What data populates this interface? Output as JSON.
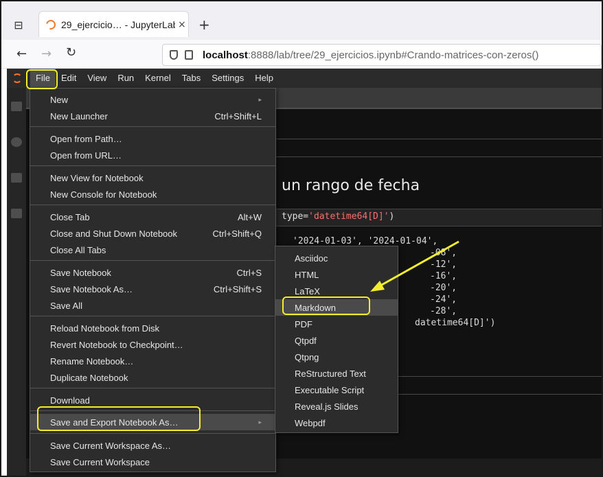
{
  "browser": {
    "tab_title": "29_ejercicio… - JupyterLab",
    "tab_close": "×",
    "new_tab": "+",
    "url_host": "localhost",
    "url_rest": ":8888/lab/tree/29_ejercicios.ipynb#Crando-matrices-con-zeros()"
  },
  "menubar": {
    "items": [
      "File",
      "Edit",
      "View",
      "Run",
      "Kernel",
      "Tabs",
      "Settings",
      "Help"
    ]
  },
  "notebook": {
    "heading": "un rango de fecha",
    "code_line_prefix": "type=",
    "code_line_string": "'datetime64[D]'",
    "code_line_suffix": ")",
    "output": {
      "line1": "'2024-01-03', '2024-01-04',",
      "line2": "-08',",
      "line3": "-12',",
      "line4": "-16',",
      "line5": "-20',",
      "line6": "-24',",
      "line7": "-28',",
      "line8": "datetime64[D]')"
    }
  },
  "file_menu": {
    "new": "New",
    "new_launcher": "New Launcher",
    "new_launcher_sc": "Ctrl+Shift+L",
    "open_from_path": "Open from Path…",
    "open_from_url": "Open from URL…",
    "new_view": "New View for Notebook",
    "new_console": "New Console for Notebook",
    "close_tab": "Close Tab",
    "close_tab_sc": "Alt+W",
    "close_shutdown": "Close and Shut Down Notebook",
    "close_shutdown_sc": "Ctrl+Shift+Q",
    "close_all": "Close All Tabs",
    "save": "Save Notebook",
    "save_sc": "Ctrl+S",
    "save_as": "Save Notebook As…",
    "save_as_sc": "Ctrl+Shift+S",
    "save_all": "Save All",
    "reload": "Reload Notebook from Disk",
    "revert": "Revert Notebook to Checkpoint…",
    "rename": "Rename Notebook…",
    "duplicate": "Duplicate Notebook",
    "download": "Download",
    "save_export": "Save and Export Notebook As…",
    "save_workspace_as": "Save Current Workspace As…",
    "save_workspace": "Save Current Workspace"
  },
  "export_submenu": {
    "items": [
      "Asciidoc",
      "HTML",
      "LaTeX",
      "Markdown",
      "PDF",
      "Qtpdf",
      "Qtpng",
      "ReStructured Text",
      "Executable Script",
      "Reveal.js Slides",
      "Webpdf"
    ]
  },
  "colors": {
    "highlight": "#f3ee2b",
    "menu_bg": "#2c2c2c",
    "jupyter_orange": "#f37726"
  }
}
